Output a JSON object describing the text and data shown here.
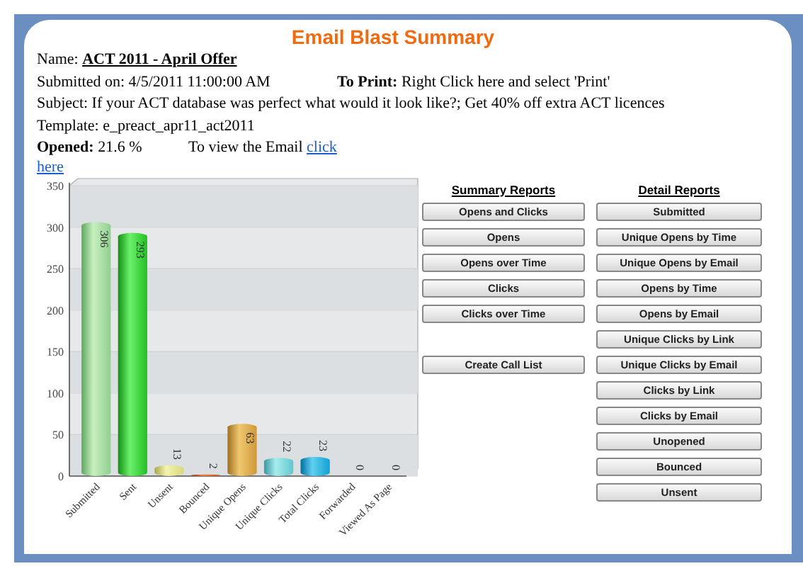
{
  "title": "Email Blast Summary",
  "name": {
    "label": "Name:",
    "value": "ACT 2011 - April Offer"
  },
  "submitted": "Submitted on: 4/5/2011 11:00:00 AM",
  "to_print": {
    "label": "To Print:",
    "text": "Right Click here and select 'Print'"
  },
  "subject": "Subject: If your ACT database was perfect what would it look like?; Get 40% off extra ACT licences",
  "template": "Template: e_preact_apr11_act2011",
  "opened": {
    "label": "Opened:",
    "value": "21.6 %"
  },
  "view_email": {
    "text": "To view the Email",
    "link": [
      "click",
      "here"
    ]
  },
  "chart_data": {
    "type": "bar",
    "categories": [
      "Submitted",
      "Sent",
      "Unsent",
      "Bounced",
      "Unique Opens",
      "Unique Clicks",
      "Total Clicks",
      "Forwarded",
      "Viewed As Page"
    ],
    "values": [
      306,
      293,
      13,
      2,
      63,
      22,
      23,
      0,
      0
    ],
    "ylim": [
      0,
      350
    ],
    "grid": true,
    "yticks": [
      0,
      50,
      100,
      150,
      200,
      250,
      300,
      350
    ],
    "data_labels": true
  },
  "summary_reports": {
    "heading": "Summary Reports",
    "buttons": [
      "Opens and Clicks",
      "Opens",
      "Opens over Time",
      "Clicks",
      "Clicks over Time"
    ],
    "extra_buttons": [
      "Create Call List"
    ]
  },
  "detail_reports": {
    "heading": "Detail Reports",
    "buttons": [
      "Submitted",
      "Unique Opens by Time",
      "Unique Opens by Email",
      "Opens by Time",
      "Opens by Email",
      "Unique Clicks by Link",
      "Unique Clicks by Email",
      "Clicks by Link",
      "Clicks by Email",
      "Unopened",
      "Bounced",
      "Unsent"
    ]
  }
}
